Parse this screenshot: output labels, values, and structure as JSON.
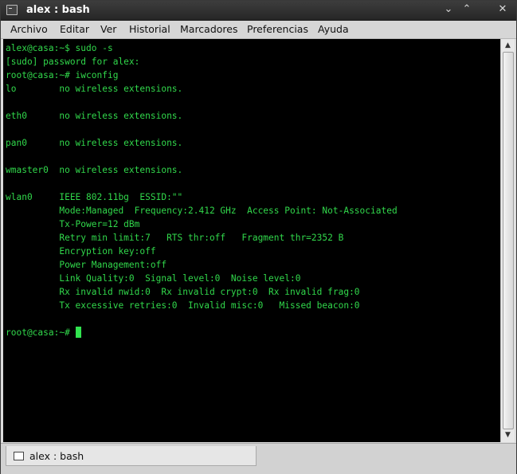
{
  "window": {
    "title": "alex : bash"
  },
  "menu": [
    "Archivo",
    "Editar",
    "Ver",
    "Historial",
    "Marcadores",
    "Preferencias",
    "Ayuda"
  ],
  "terminal": {
    "lines": [
      "alex@casa:~$ sudo -s",
      "[sudo] password for alex:",
      "root@casa:~# iwconfig",
      "lo        no wireless extensions.",
      "",
      "eth0      no wireless extensions.",
      "",
      "pan0      no wireless extensions.",
      "",
      "wmaster0  no wireless extensions.",
      "",
      "wlan0     IEEE 802.11bg  ESSID:\"\"",
      "          Mode:Managed  Frequency:2.412 GHz  Access Point: Not-Associated",
      "          Tx-Power=12 dBm",
      "          Retry min limit:7   RTS thr:off   Fragment thr=2352 B",
      "          Encryption key:off",
      "          Power Management:off",
      "          Link Quality:0  Signal level:0  Noise level:0",
      "          Rx invalid nwid:0  Rx invalid crypt:0  Rx invalid frag:0",
      "          Tx excessive retries:0  Invalid misc:0   Missed beacon:0",
      ""
    ],
    "prompt": "root@casa:~# "
  },
  "tabs": [
    {
      "label": "alex : bash"
    }
  ],
  "icons": {
    "window": "terminal-icon",
    "minimize": "minimize-icon",
    "maximize": "maximize-icon",
    "close": "close-icon",
    "scroll_up": "scroll-up-arrow-icon",
    "scroll_down": "scroll-down-arrow-icon"
  },
  "colors": {
    "terminal_bg": "#000000",
    "terminal_fg": "#31d84b",
    "titlebar": "#2e2e2e"
  }
}
